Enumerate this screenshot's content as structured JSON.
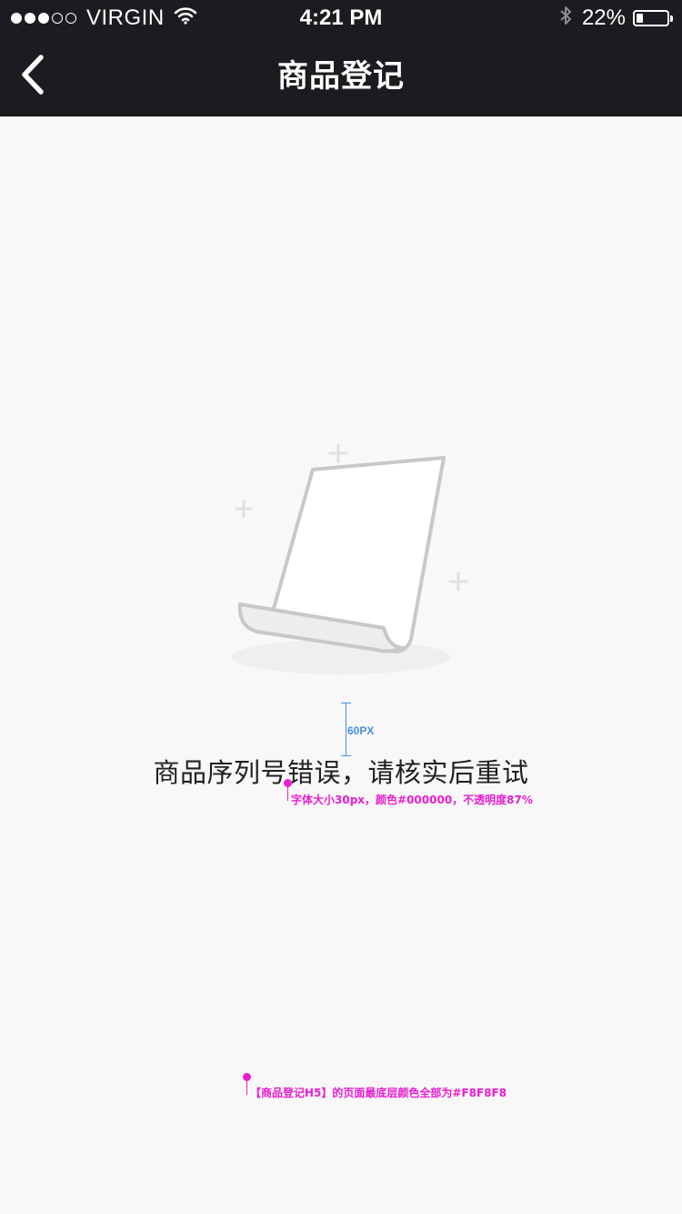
{
  "status_bar": {
    "signal_full": 3,
    "signal_empty": 2,
    "carrier": "VIRGIN",
    "time": "4:21 PM",
    "battery_percent": "22%",
    "battery_level": 0.22,
    "icons": [
      "wifi-icon",
      "bluetooth-icon",
      "battery-icon"
    ]
  },
  "nav": {
    "title": "商品登记",
    "back_icon": "chevron-left-icon"
  },
  "empty_state": {
    "illustration": "document-icon",
    "message": "商品序列号错误，请核实后重试"
  },
  "annotations": {
    "spacing_label": "60PX",
    "font_note": "字体大小30px，颜色#000000，不透明度87%",
    "background_note": "【商品登记H5】的页面最底层颜色全部为#F8F8F8"
  },
  "colors": {
    "header_bg": "#1C1B1F",
    "page_bg": "#F8F8F8",
    "annotation_pink": "#E91ECF",
    "annotation_blue": "#4A90E2"
  }
}
